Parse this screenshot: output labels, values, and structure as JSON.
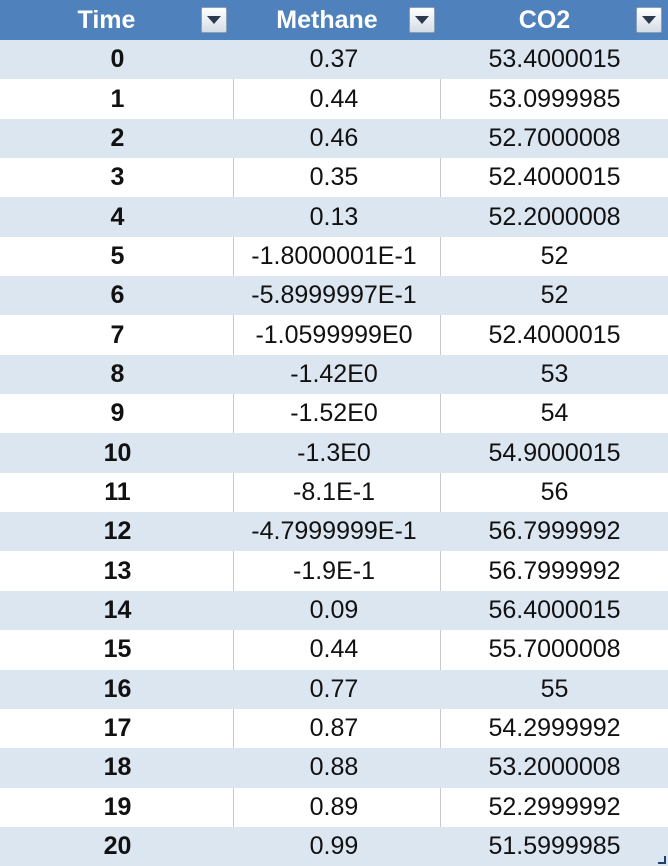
{
  "table": {
    "headers": {
      "time": "Time",
      "methane": "Methane",
      "co2": "CO2"
    },
    "rows": [
      {
        "time": "0",
        "methane": "0.37",
        "co2": "53.4000015"
      },
      {
        "time": "1",
        "methane": "0.44",
        "co2": "53.0999985"
      },
      {
        "time": "2",
        "methane": "0.46",
        "co2": "52.7000008"
      },
      {
        "time": "3",
        "methane": "0.35",
        "co2": "52.4000015"
      },
      {
        "time": "4",
        "methane": "0.13",
        "co2": "52.2000008"
      },
      {
        "time": "5",
        "methane": "-1.8000001E-1",
        "co2": "52"
      },
      {
        "time": "6",
        "methane": "-5.8999997E-1",
        "co2": "52"
      },
      {
        "time": "7",
        "methane": "-1.0599999E0",
        "co2": "52.4000015"
      },
      {
        "time": "8",
        "methane": "-1.42E0",
        "co2": "53"
      },
      {
        "time": "9",
        "methane": "-1.52E0",
        "co2": "54"
      },
      {
        "time": "10",
        "methane": "-1.3E0",
        "co2": "54.9000015"
      },
      {
        "time": "11",
        "methane": "-8.1E-1",
        "co2": "56"
      },
      {
        "time": "12",
        "methane": "-4.7999999E-1",
        "co2": "56.7999992"
      },
      {
        "time": "13",
        "methane": "-1.9E-1",
        "co2": "56.7999992"
      },
      {
        "time": "14",
        "methane": "0.09",
        "co2": "56.4000015"
      },
      {
        "time": "15",
        "methane": "0.44",
        "co2": "55.7000008"
      },
      {
        "time": "16",
        "methane": "0.77",
        "co2": "55"
      },
      {
        "time": "17",
        "methane": "0.87",
        "co2": "54.2999992"
      },
      {
        "time": "18",
        "methane": "0.88",
        "co2": "53.2000008"
      },
      {
        "time": "19",
        "methane": "0.89",
        "co2": "52.2999992"
      },
      {
        "time": "20",
        "methane": "0.99",
        "co2": "51.5999985"
      }
    ]
  },
  "icons": {
    "filter": "filter-dropdown-icon"
  },
  "colors": {
    "header_bg": "#4f81bd",
    "band_bg": "#dce6f1",
    "header_text": "#ffffff"
  }
}
